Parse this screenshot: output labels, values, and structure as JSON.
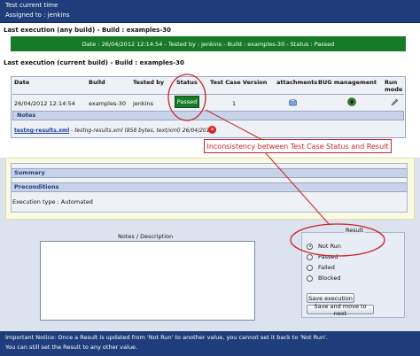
{
  "header": {
    "title": "Test current time",
    "assigned": "Assigned to : jenkins"
  },
  "last_any": {
    "title": "Last execution (any build) - Build : examples-30",
    "summary": "Date : 26/04/2012 12:14:54 - Tested by : jenkins - Build : examples-30 - Status : Passed"
  },
  "last_current": {
    "title": "Last execution (current build) - Build : examples-30",
    "headers": {
      "date": "Date",
      "build": "Build",
      "tested_by": "Tested by",
      "status": "Status",
      "version": "Test Case Version",
      "attachments": "attachments",
      "bug": "BUG management",
      "run_mode": "Run mode"
    },
    "row": {
      "date": "26/04/2012 12:14:54",
      "build": "examples-30",
      "tested_by": "jenkins",
      "status": "Passed",
      "version": "1"
    },
    "notes_label": "Notes",
    "attachment_link": "testng-results.xml",
    "attachment_info": "- testng-results.xml (858 bytes, text/xml) 26/04/2012"
  },
  "annotation": "Inconsistency between Test Case Status and Result",
  "panel": {
    "summary": "Summary",
    "preconditions": "Preconditions",
    "exec_type": "Execution type : Automated"
  },
  "notes_desc_label": "Notes / Description",
  "result": {
    "title": "Result",
    "options": [
      "Not Run",
      "Passed",
      "Failed",
      "Blocked"
    ],
    "selected": "Not Run",
    "save_button": "Save execution",
    "save_next_button": "Save and move to next"
  },
  "footer": {
    "line1": "Important Notice: Once a Result is updated from 'Not Run' to another value, you cannot set it back to 'Not Run'.",
    "line2": "You can still set the Result to any other value."
  },
  "colors": {
    "header_bg": "#1e3d7a",
    "passed_green": "#177a27",
    "annotation_red": "#c7262a"
  }
}
